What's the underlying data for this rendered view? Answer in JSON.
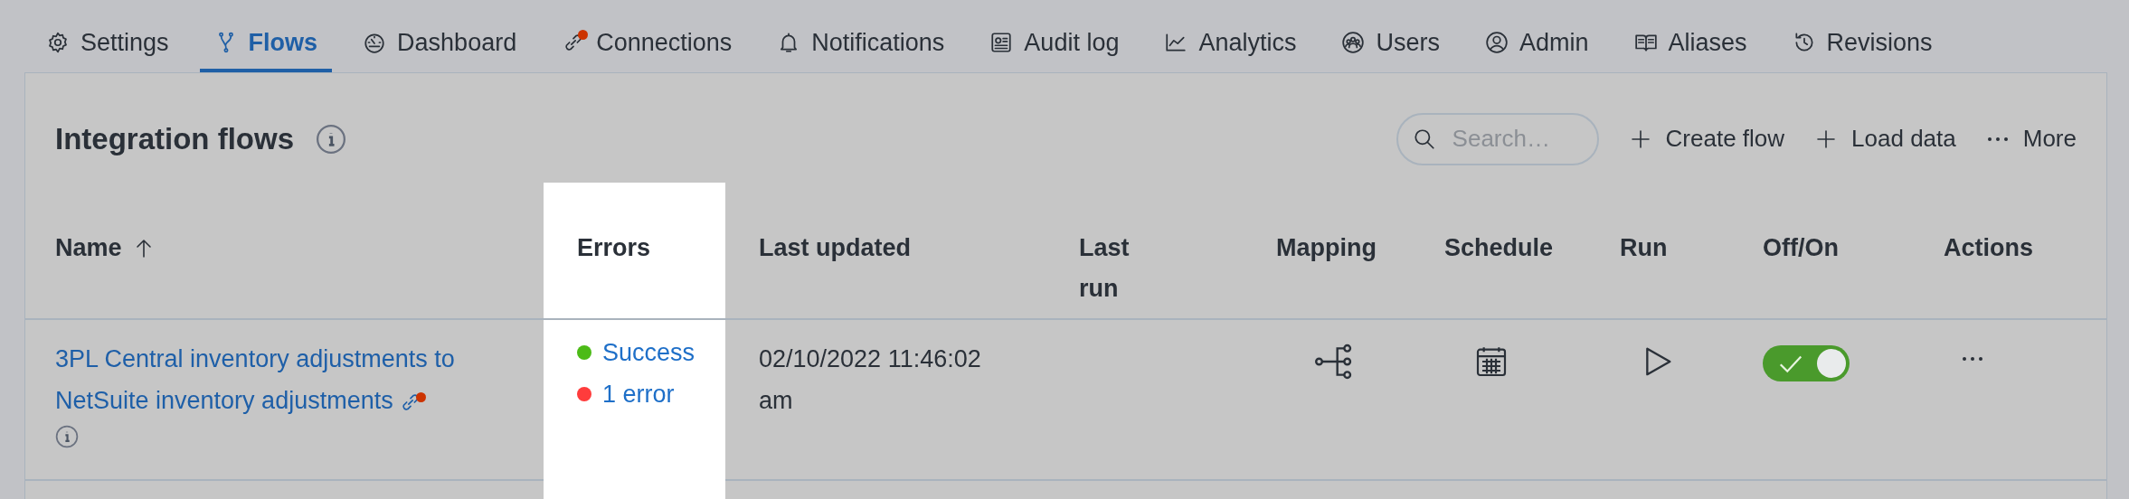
{
  "tabs": [
    {
      "label": "Settings",
      "kind": "gear",
      "selected": false,
      "alert": false
    },
    {
      "label": "Flows",
      "kind": "flow",
      "selected": true,
      "alert": false
    },
    {
      "label": "Dashboard",
      "kind": "gauge",
      "selected": false,
      "alert": false
    },
    {
      "label": "Connections",
      "kind": "link",
      "selected": false,
      "alert": true
    },
    {
      "label": "Notifications",
      "kind": "bell",
      "selected": false,
      "alert": false
    },
    {
      "label": "Audit log",
      "kind": "log",
      "selected": false,
      "alert": false
    },
    {
      "label": "Analytics",
      "kind": "chart",
      "selected": false,
      "alert": false
    },
    {
      "label": "Users",
      "kind": "users",
      "selected": false,
      "alert": false
    },
    {
      "label": "Admin",
      "kind": "user",
      "selected": false,
      "alert": false
    },
    {
      "label": "Aliases",
      "kind": "book",
      "selected": false,
      "alert": false
    },
    {
      "label": "Revisions",
      "kind": "history",
      "selected": false,
      "alert": false
    }
  ],
  "panel": {
    "title": "Integration flows",
    "search": {
      "placeholder": "Search…"
    },
    "actions": [
      {
        "label": "Create flow",
        "kind": "plus"
      },
      {
        "label": "Load data",
        "kind": "plus"
      },
      {
        "label": "More",
        "kind": "dots"
      }
    ]
  },
  "table": {
    "columns": [
      {
        "label": "Name",
        "sorted": true,
        "highlighted": false
      },
      {
        "label": "Errors",
        "sorted": false,
        "highlighted": true
      },
      {
        "label": "Last updated",
        "sorted": false,
        "highlighted": false
      },
      {
        "label": "Last run",
        "sorted": false,
        "highlighted": false
      },
      {
        "label": "Mapping",
        "sorted": false,
        "highlighted": false
      },
      {
        "label": "Schedule",
        "sorted": false,
        "highlighted": false
      },
      {
        "label": "Run",
        "sorted": false,
        "highlighted": false
      },
      {
        "label": "Off/On",
        "sorted": false,
        "highlighted": false
      },
      {
        "label": "Actions",
        "sorted": false,
        "highlighted": false
      }
    ],
    "rows": [
      {
        "name": "3PL Central inventory adjustments to NetSuite inventory adjustments",
        "connection_alert": true,
        "errors": [
          {
            "label": "Success",
            "color": "#4cbb17"
          },
          {
            "label": "1 error",
            "color": "#ff3c3c"
          }
        ],
        "last_updated": "02/10/2022 11:46:02 am",
        "on": true
      }
    ]
  }
}
